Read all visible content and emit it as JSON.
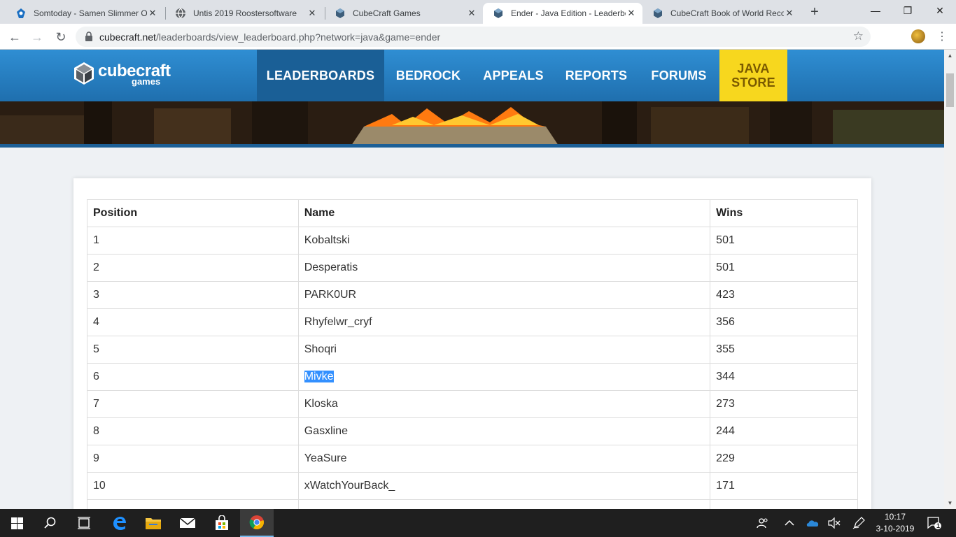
{
  "browser": {
    "tabs": [
      {
        "title": "Somtoday - Samen Slimmer Ol",
        "icon": "somtoday-icon",
        "active": false
      },
      {
        "title": "Untis 2019 Roostersoftware",
        "icon": "globe-icon",
        "active": false
      },
      {
        "title": "CubeCraft Games",
        "icon": "cubecraft-icon",
        "active": false
      },
      {
        "title": "Ender - Java Edition - Leaderbo",
        "icon": "cubecraft-icon",
        "active": true
      },
      {
        "title": "CubeCraft Book of World Reco",
        "icon": "cubecraft-icon",
        "active": false
      }
    ],
    "new_tab": "+",
    "window_controls": {
      "minimize": "—",
      "maximize": "❐",
      "close": "✕"
    },
    "nav": {
      "back": "←",
      "forward": "→",
      "reload": "↻"
    },
    "url_host": "cubecraft.net",
    "url_path": "/leaderboards/view_leaderboard.php?network=java&game=ender",
    "bookmark_star": "☆",
    "menu": "⋮"
  },
  "site": {
    "logo_main": "cubecraft",
    "logo_sub": "games",
    "nav": {
      "leaderboards": "LEADERBOARDS",
      "bedrock": "BEDROCK",
      "appeals": "APPEALS",
      "reports": "REPORTS",
      "forums": "FORUMS",
      "store_line1": "JAVA",
      "store_line2": "STORE"
    },
    "colors": {
      "nav_blue": "#2f8ed3",
      "nav_active": "#1a5f96",
      "store_yellow": "#f7d71e",
      "selection": "#3390ff"
    }
  },
  "leaderboard": {
    "headers": {
      "position": "Position",
      "name": "Name",
      "wins": "Wins"
    },
    "rows": [
      {
        "position": "1",
        "name": "Kobaltski",
        "wins": "501"
      },
      {
        "position": "2",
        "name": "Desperatis",
        "wins": "501"
      },
      {
        "position": "3",
        "name": "PARK0UR",
        "wins": "423"
      },
      {
        "position": "4",
        "name": "Rhyfelwr_cryf",
        "wins": "356"
      },
      {
        "position": "5",
        "name": "Shoqri",
        "wins": "355"
      },
      {
        "position": "6",
        "name": "Mivke",
        "wins": "344",
        "selected": true
      },
      {
        "position": "7",
        "name": "Kloska",
        "wins": "273"
      },
      {
        "position": "8",
        "name": "Gasxline",
        "wins": "244"
      },
      {
        "position": "9",
        "name": "YeaSure",
        "wins": "229"
      },
      {
        "position": "10",
        "name": "xWatchYourBack_",
        "wins": "171"
      }
    ]
  },
  "taskbar": {
    "clock_time": "10:17",
    "clock_date": "3-10-2019",
    "notification_count": "1",
    "apps": [
      "start-icon",
      "search-icon",
      "task-view-icon",
      "edge-icon",
      "file-explorer-icon",
      "mail-icon",
      "store-icon",
      "chrome-icon"
    ]
  }
}
